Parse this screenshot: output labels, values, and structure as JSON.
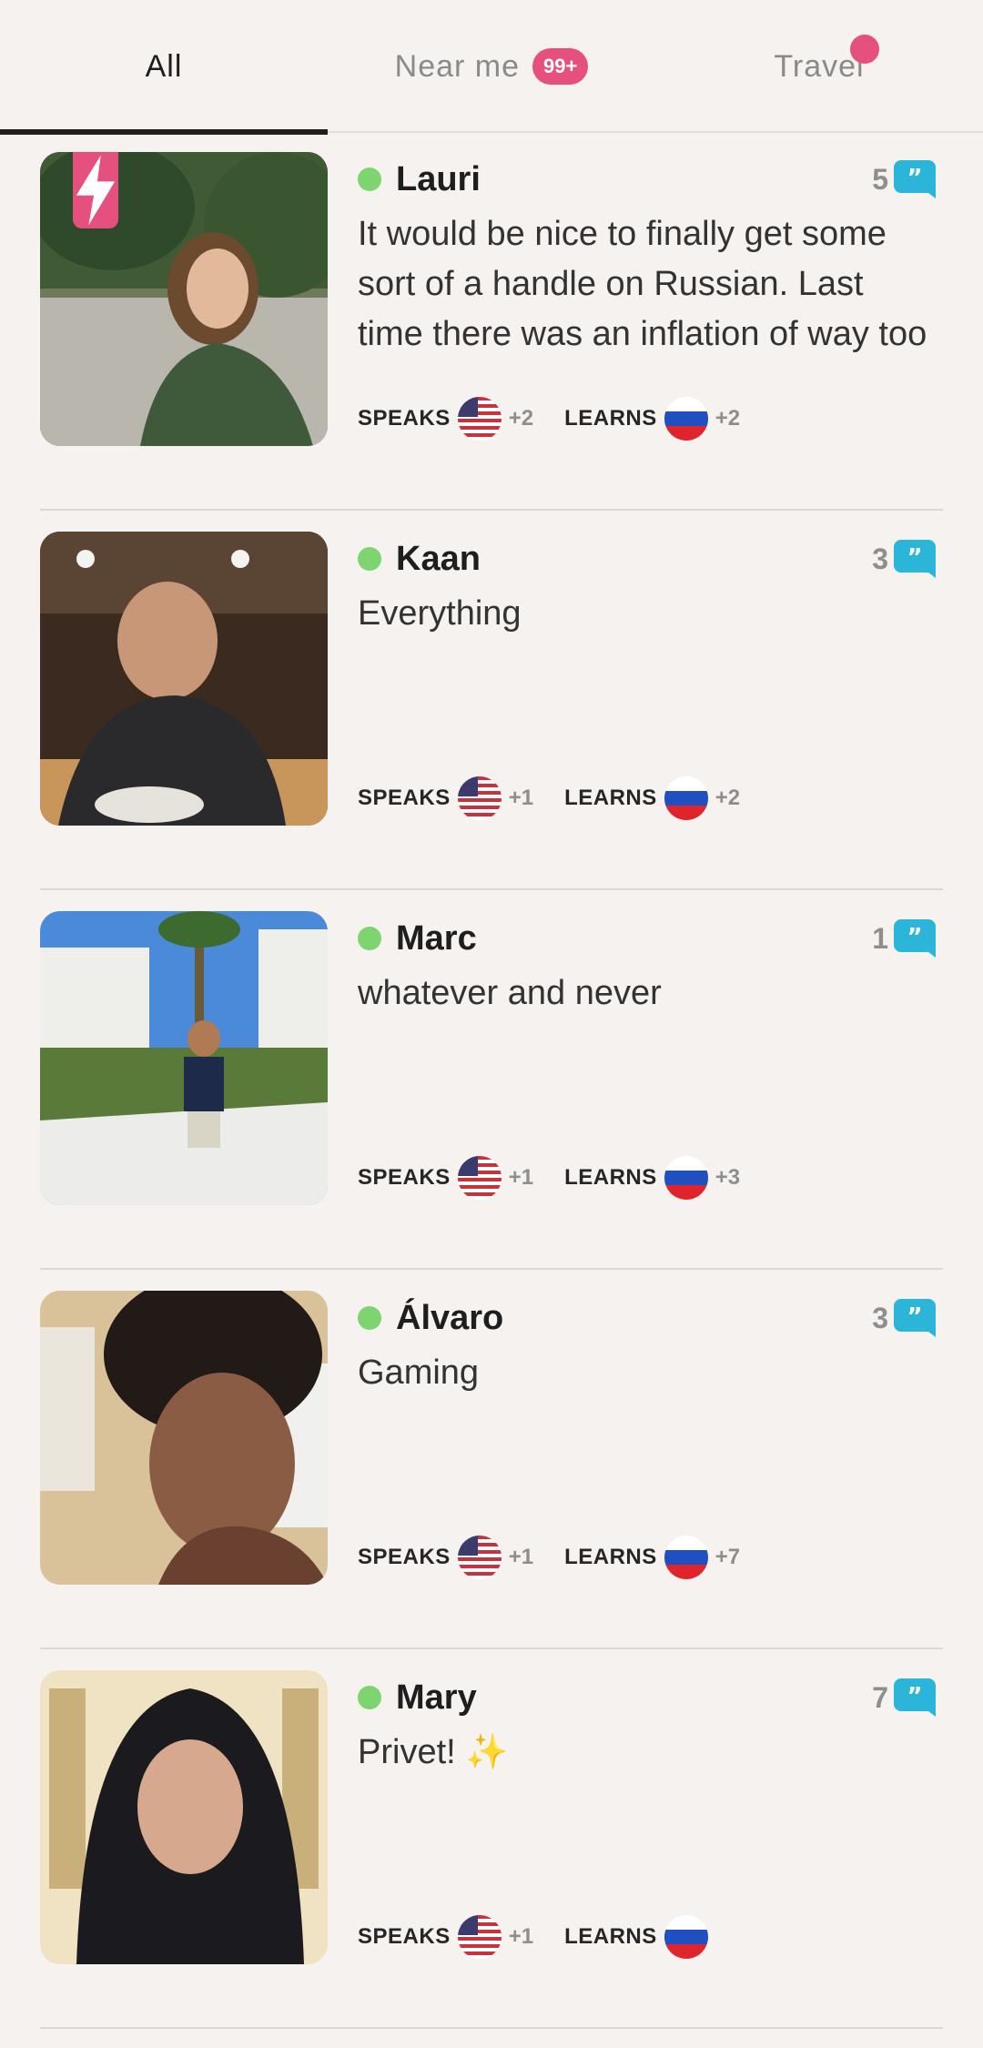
{
  "tabs": [
    {
      "label": "All",
      "active": true
    },
    {
      "label": "Near me",
      "badge": "99+"
    },
    {
      "label": "Travel",
      "dot": true
    }
  ],
  "colors": {
    "accent": "#e6507e",
    "online": "#7ed56f",
    "quote": "#2bb5d9"
  },
  "labels": {
    "speaks": "SPEAKS",
    "learns": "LEARNS"
  },
  "partners": [
    {
      "name": "Lauri",
      "refs": "5",
      "bio": "It would be nice to finally get some sort of a handle on Russian. Last time there was an inflation of way too",
      "speaks_flag": "us-flag",
      "speaks_more": "+2",
      "learns_flag": "ru-flag",
      "learns_more": "+2",
      "boost": true,
      "icon": "lightning-icon"
    },
    {
      "name": "Kaan",
      "refs": "3",
      "bio": "Everything",
      "speaks_flag": "us-flag",
      "speaks_more": "+1",
      "learns_flag": "ru-flag",
      "learns_more": "+2"
    },
    {
      "name": "Marc",
      "refs": "1",
      "bio": "whatever and never",
      "speaks_flag": "us-flag",
      "speaks_more": "+1",
      "learns_flag": "ru-flag",
      "learns_more": "+3"
    },
    {
      "name": "Álvaro",
      "refs": "3",
      "bio": "Gaming",
      "speaks_flag": "us-flag",
      "speaks_more": "+1",
      "learns_flag": "ru-flag",
      "learns_more": "+7"
    },
    {
      "name": "Mary",
      "refs": "7",
      "bio": "Privet! ✨",
      "speaks_flag": "us-flag",
      "speaks_more": "+1",
      "learns_flag": "ru-flag",
      "learns_more": ""
    }
  ]
}
